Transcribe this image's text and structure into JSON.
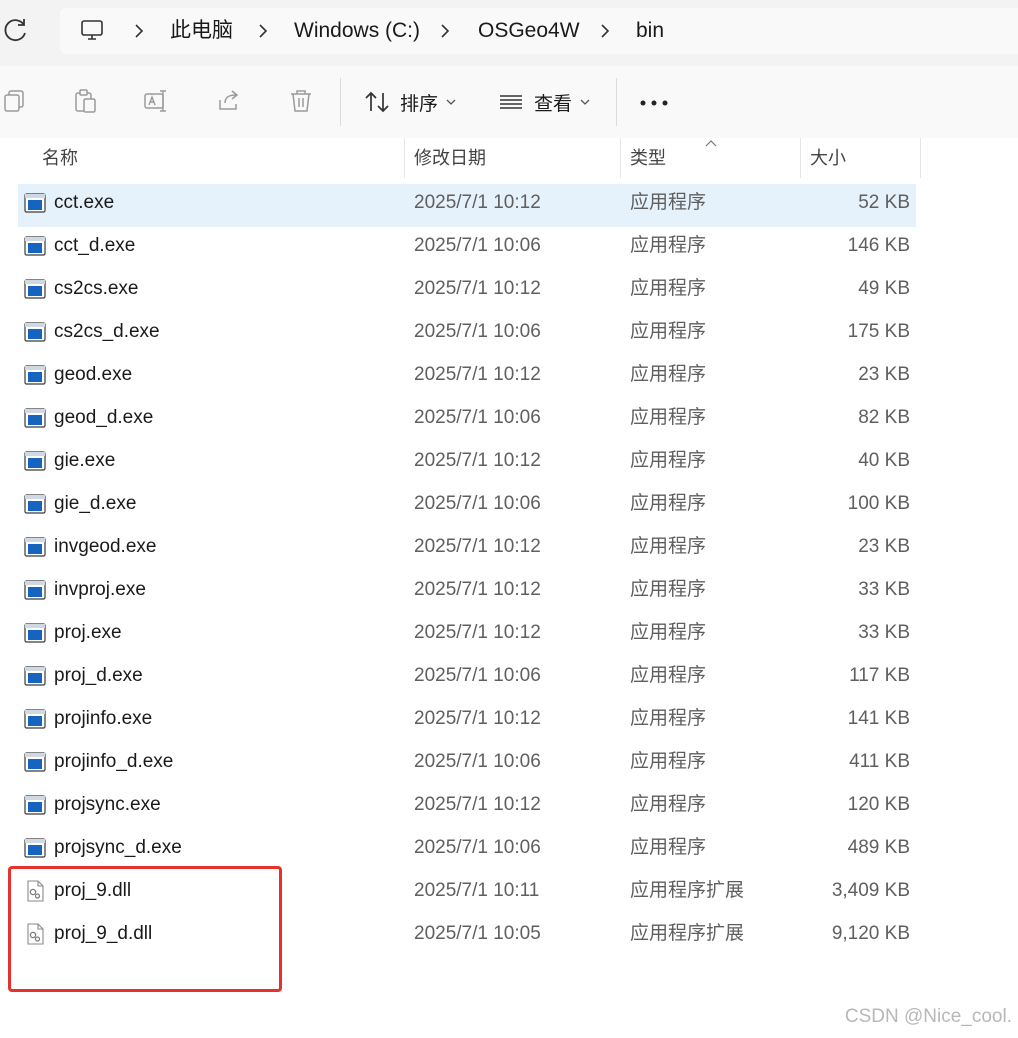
{
  "address_bar": {
    "computer_icon": "computer-icon",
    "breadcrumbs": [
      "此电脑",
      "Windows (C:)",
      "OSGeo4W",
      "bin"
    ]
  },
  "toolbar": {
    "icons": [
      "copy-icon",
      "paste-icon",
      "rename-icon",
      "share-icon",
      "delete-icon"
    ],
    "sort_label": "排序",
    "view_label": "查看",
    "more_icon": "more-options-icon"
  },
  "columns": {
    "name": "名称",
    "date": "修改日期",
    "type": "类型",
    "size": "大小"
  },
  "files": [
    {
      "name": "cct.exe",
      "date": "2025/7/1 10:12",
      "type": "应用程序",
      "size": "52 KB",
      "icon": "exe-icon",
      "selected": true
    },
    {
      "name": "cct_d.exe",
      "date": "2025/7/1 10:06",
      "type": "应用程序",
      "size": "146 KB",
      "icon": "exe-icon"
    },
    {
      "name": "cs2cs.exe",
      "date": "2025/7/1 10:12",
      "type": "应用程序",
      "size": "49 KB",
      "icon": "exe-icon"
    },
    {
      "name": "cs2cs_d.exe",
      "date": "2025/7/1 10:06",
      "type": "应用程序",
      "size": "175 KB",
      "icon": "exe-icon"
    },
    {
      "name": "geod.exe",
      "date": "2025/7/1 10:12",
      "type": "应用程序",
      "size": "23 KB",
      "icon": "exe-icon"
    },
    {
      "name": "geod_d.exe",
      "date": "2025/7/1 10:06",
      "type": "应用程序",
      "size": "82 KB",
      "icon": "exe-icon"
    },
    {
      "name": "gie.exe",
      "date": "2025/7/1 10:12",
      "type": "应用程序",
      "size": "40 KB",
      "icon": "exe-icon"
    },
    {
      "name": "gie_d.exe",
      "date": "2025/7/1 10:06",
      "type": "应用程序",
      "size": "100 KB",
      "icon": "exe-icon"
    },
    {
      "name": "invgeod.exe",
      "date": "2025/7/1 10:12",
      "type": "应用程序",
      "size": "23 KB",
      "icon": "exe-icon"
    },
    {
      "name": "invproj.exe",
      "date": "2025/7/1 10:12",
      "type": "应用程序",
      "size": "33 KB",
      "icon": "exe-icon"
    },
    {
      "name": "proj.exe",
      "date": "2025/7/1 10:12",
      "type": "应用程序",
      "size": "33 KB",
      "icon": "exe-icon"
    },
    {
      "name": "proj_d.exe",
      "date": "2025/7/1 10:06",
      "type": "应用程序",
      "size": "117 KB",
      "icon": "exe-icon"
    },
    {
      "name": "projinfo.exe",
      "date": "2025/7/1 10:12",
      "type": "应用程序",
      "size": "141 KB",
      "icon": "exe-icon"
    },
    {
      "name": "projinfo_d.exe",
      "date": "2025/7/1 10:06",
      "type": "应用程序",
      "size": "411 KB",
      "icon": "exe-icon"
    },
    {
      "name": "projsync.exe",
      "date": "2025/7/1 10:12",
      "type": "应用程序",
      "size": "120 KB",
      "icon": "exe-icon"
    },
    {
      "name": "projsync_d.exe",
      "date": "2025/7/1 10:06",
      "type": "应用程序",
      "size": "489 KB",
      "icon": "exe-icon"
    },
    {
      "name": "proj_9.dll",
      "date": "2025/7/1 10:11",
      "type": "应用程序扩展",
      "size": "3,409 KB",
      "icon": "dll-icon"
    },
    {
      "name": "proj_9_d.dll",
      "date": "2025/7/1 10:05",
      "type": "应用程序扩展",
      "size": "9,120 KB",
      "icon": "dll-icon"
    }
  ],
  "colors": {
    "selected_row": "#e5f1fb",
    "exe_icon_blue": "#1565c0",
    "highlight_box": "#e5322d"
  },
  "watermark": "CSDN @Nice_cool."
}
